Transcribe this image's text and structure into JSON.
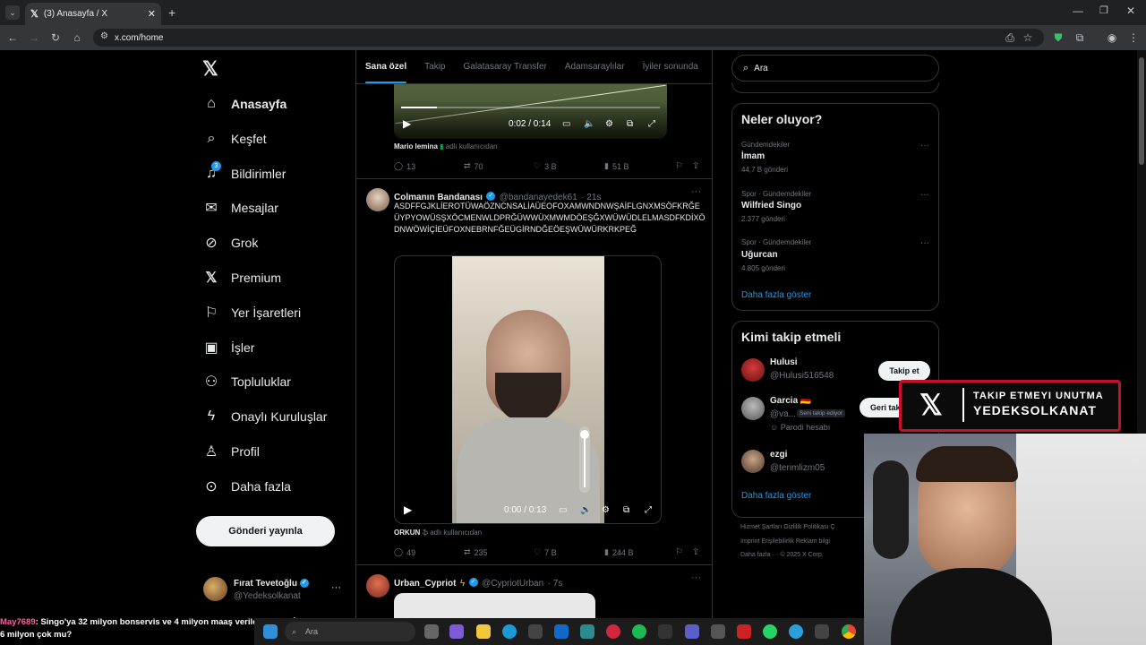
{
  "browser": {
    "tab_title": "(3) Anasayfa / X",
    "tab_icon": "x-logo-icon",
    "url": "x.com/home"
  },
  "nav": {
    "logo": "𝕏",
    "items": [
      {
        "label": "Anasayfa",
        "icon": "home-icon",
        "active": true
      },
      {
        "label": "Keşfet",
        "icon": "search-icon"
      },
      {
        "label": "Bildirimler",
        "icon": "bell-icon",
        "badge": "3"
      },
      {
        "label": "Mesajlar",
        "icon": "mail-icon"
      },
      {
        "label": "Grok",
        "icon": "grok-icon"
      },
      {
        "label": "Premium",
        "icon": "x-logo-icon"
      },
      {
        "label": "Yer İşaretleri",
        "icon": "bookmark-icon"
      },
      {
        "label": "İşler",
        "icon": "briefcase-icon"
      },
      {
        "label": "Topluluklar",
        "icon": "people-icon"
      },
      {
        "label": "Onaylı Kuruluşlar",
        "icon": "lightning-icon"
      },
      {
        "label": "Profil",
        "icon": "person-icon"
      },
      {
        "label": "Daha fazla",
        "icon": "more-circle-icon"
      }
    ],
    "post_button": "Gönderi yayınla",
    "account": {
      "name": "Fırat Tevetoğlu",
      "handle": "@Yedeksolkanat",
      "more": "···"
    }
  },
  "timeline": {
    "tabs": [
      "Sana özel",
      "Takip",
      "Galatasaray Transfer",
      "Adamsaraylılar",
      "İyiler sonunda"
    ],
    "post1": {
      "video_time": "0:02 / 0:14",
      "media_credit_name": "Mario lemina",
      "media_credit_suffix": "adlı kullanıcıdan",
      "replies": "13",
      "reposts": "70",
      "likes": "3 B",
      "views": "51 B"
    },
    "post2": {
      "name": "Colmanın Bandanası",
      "handle": "@bandanayedek61",
      "time": "· 21s",
      "text": "ASDFFGJKLİEROTÜWAÖZNCNSALİAÜEOFOXAMWNDNWŞAİFLGNXMSÖFKRĞEÜYPYOWÜSŞXÖCMENWLDPRĞÜWWÜXMWMDÖEŞĞXWÜWÜDLELMASDFKDİXÖDNWÖWİÇİEÜFOXNEBRNFĞEÜGİRNDĞEÖEŞWÜWÜRKRKPEĞ",
      "video_time": "0:00 / 0:13",
      "media_credit_name": "ORKUN",
      "media_credit_suffix": "adlı kullanıcıdan",
      "replies": "49",
      "reposts": "235",
      "likes": "7 B",
      "views": "244 B"
    },
    "post3": {
      "name": "Urban_Cypriot",
      "handle": "@CypriotUrban",
      "time": "· 7s"
    }
  },
  "right": {
    "search_placeholder": "Ara",
    "trends_title": "Neler oluyor?",
    "trends": [
      {
        "meta": "Gündemdekiler",
        "name": "İmam",
        "count": "44,7 B gönderi"
      },
      {
        "meta": "Spor · Gündemdekiler",
        "name": "Wilfried Singo",
        "count": "2.377 gönderi"
      },
      {
        "meta": "Spor · Gündemdekiler",
        "name": "Uğurcan",
        "count": "4.805 gönderi"
      }
    ],
    "show_more": "Daha fazla göster",
    "who_title": "Kimi takip etmeli",
    "who": [
      {
        "name": "Hulusi",
        "handle": "@Hulusi516548",
        "button": "Takip et"
      },
      {
        "name": "Garcia 🇩🇪",
        "handle": "@va...",
        "tag": "Seni takip ediyor",
        "note": "Parodi hesabı",
        "button": "Geri takip et"
      },
      {
        "name": "ezgi",
        "handle": "@terimlizm05"
      }
    ],
    "who_show_more": "Daha fazla göster",
    "footer": {
      "line1": "Hizmet Şartları   Gizlilik Politikası   Ç",
      "line2": "Imprint   Erişilebilirlik   Reklam bilgi",
      "line3": "Daha fazla ···   © 2025 X Corp."
    }
  },
  "overlay": {
    "banner_line1": "TAKIP ETMEYI UNUTMA",
    "banner_line2": "YEDEKSOLKANAT",
    "chat_user": "May7689",
    "chat_text": ": Singo'ya 32 milyon bonservis ve 4 milyon maaş verilecek ama İlkay'a 6 milyon çok mu?"
  },
  "taskbar": {
    "search_placeholder": "Ara"
  },
  "colors": {
    "accent": "#1d9bf0",
    "banner_border": "#c8102e",
    "chat_user": "#ff5fa2"
  }
}
